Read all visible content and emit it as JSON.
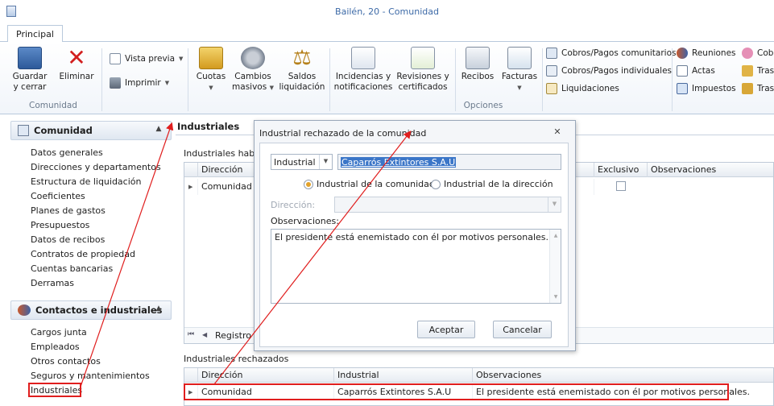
{
  "window": {
    "title": "Bailén, 20 - Comunidad"
  },
  "tabs": [
    "Principal"
  ],
  "ribbon": {
    "comunidad": {
      "group_label": "Comunidad",
      "guardar": [
        "Guardar",
        "y cerrar"
      ],
      "eliminar": "Eliminar"
    },
    "print": {
      "vista_previa": "Vista previa",
      "imprimir": "Imprimir"
    },
    "opciones": {
      "group_label": "Opciones",
      "cuotas": "Cuotas",
      "cambios_masivos": [
        "Cambios",
        "masivos"
      ],
      "saldos": [
        "Saldos",
        "liquidación"
      ],
      "incidencias": [
        "Incidencias y",
        "notificaciones"
      ],
      "revisiones": [
        "Revisiones y",
        "certificados"
      ],
      "recibos": "Recibos",
      "facturas": "Facturas",
      "cobros_comunitarios": "Cobros/Pagos comunitarios",
      "cobros_individuales": "Cobros/Pagos individuales",
      "liquidaciones": "Liquidaciones",
      "reuniones": "Reuniones",
      "actas": "Actas",
      "impuestos": "Impuestos",
      "cob": "Cob",
      "tras1": "Tras",
      "tras2": "Tras"
    }
  },
  "sidebar": {
    "comunidad": {
      "header": "Comunidad",
      "items": [
        "Datos generales",
        "Direcciones y departamentos",
        "Estructura de liquidación",
        "Coeficientes",
        "Planes de gastos",
        "Presupuestos",
        "Datos de recibos",
        "Contratos de propiedad",
        "Cuentas bancarias",
        "Derramas"
      ]
    },
    "contactos": {
      "header": "Contactos e industriales",
      "items": [
        "Cargos junta",
        "Empleados",
        "Otros contactos",
        "Seguros y mantenimientos",
        "Industriales"
      ]
    }
  },
  "content": {
    "title": "Industriales",
    "habituales": {
      "label": "Industriales habitu",
      "columns": [
        "Dirección",
        "Exclusivo",
        "Observaciones"
      ],
      "rows": [
        {
          "direccion": "Comunidad"
        }
      ],
      "nav_label": "Registro 1"
    },
    "rechazados": {
      "label": "Industriales rechazados",
      "columns": [
        "Dirección",
        "Industrial",
        "Observaciones"
      ],
      "rows": [
        {
          "direccion": "Comunidad",
          "industrial": "Caparrós Extintores S.A.U",
          "observaciones": "El presidente está enemistado con él por motivos personales."
        }
      ]
    }
  },
  "dialog": {
    "title": "Industrial rechazado de la comunidad",
    "type_combo": "Industrial",
    "name_value": "Caparrós Extintores S.A.U",
    "radio_comunidad": "Industrial de la comunidad",
    "radio_direccion": "Industrial de la dirección",
    "selected_radio": "comunidad",
    "direccion_label": "Dirección:",
    "observaciones_label": "Observaciones:",
    "observaciones_value": "El presidente está enemistado con él por motivos personales.",
    "aceptar": "Aceptar",
    "cancelar": "Cancelar"
  },
  "colors": {
    "annotation": "#e01e1e",
    "title_text": "#3d6aa7",
    "selection": "#3b76c8",
    "radio_selected": "#e2a22b"
  }
}
